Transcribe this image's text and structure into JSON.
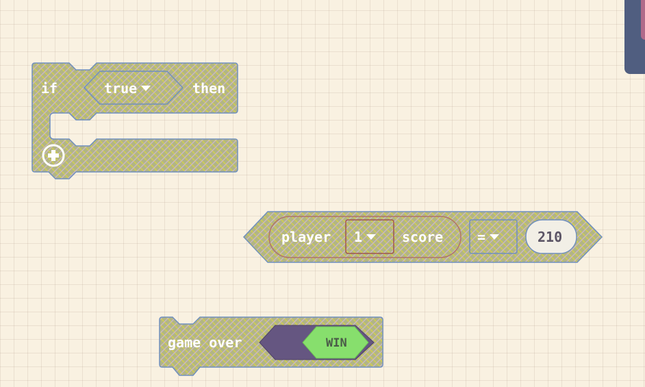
{
  "colors": {
    "canvas": "#f9f1e1",
    "block_fill": "#b2b585",
    "block_stroke": "#6f8fbf",
    "hatch": "#d6d24a",
    "hatch_alt": "#c9b8c4",
    "operator_dark": "#655681",
    "win_green": "#87df6d",
    "number_pill": "#f2efe6",
    "toolbox": "#505e80",
    "toolbox_accent": "#b06a8a"
  },
  "if_block": {
    "if_label": "if",
    "condition_value": "true",
    "then_label": "then",
    "add_icon": "plus-circle-icon"
  },
  "compare_block": {
    "player_label": "player",
    "player_number": "1",
    "score_label": "score",
    "operator": "=",
    "value": "210"
  },
  "game_over_block": {
    "label": "game over",
    "result": "WIN"
  }
}
